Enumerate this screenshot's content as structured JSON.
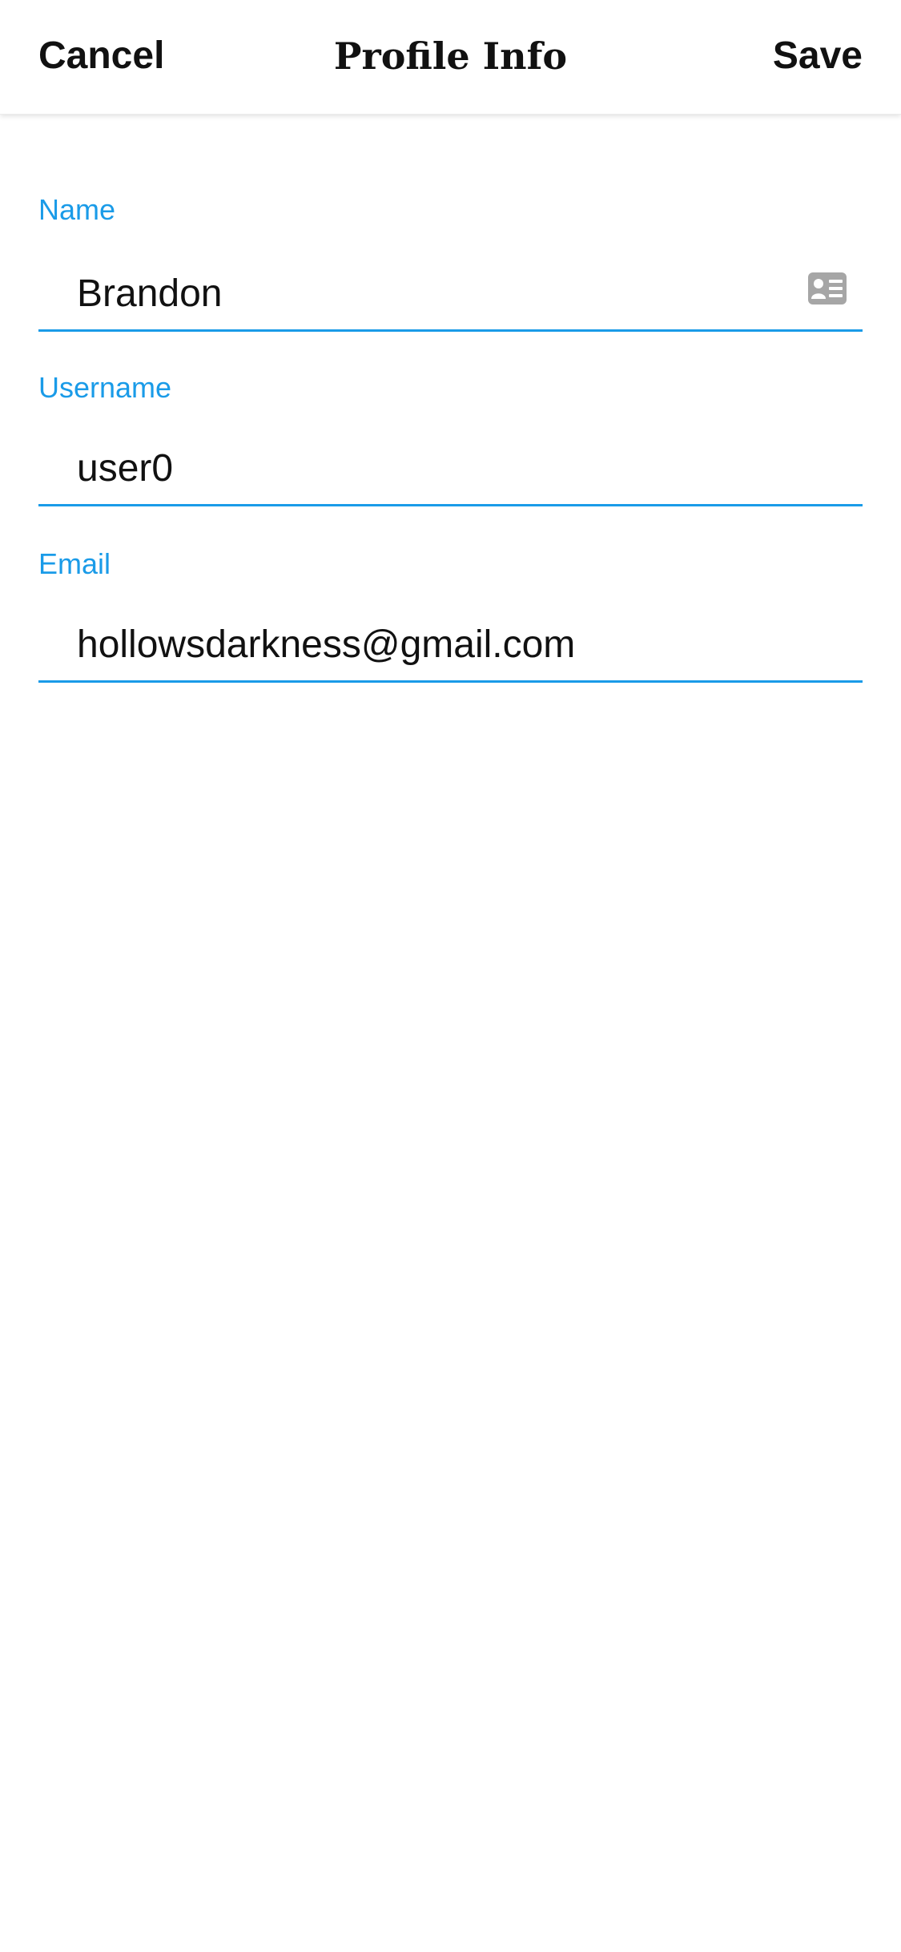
{
  "nav": {
    "cancel_label": "Cancel",
    "title": "Profile Info",
    "save_label": "Save"
  },
  "fields": [
    {
      "label": "Name",
      "value": "Brandon"
    },
    {
      "label": "Username",
      "value": "user0"
    },
    {
      "label": "Email",
      "value": "hollowsdarkness@gmail.com"
    }
  ],
  "icons": {
    "name_field_icon": "contact-card-icon"
  },
  "colors": {
    "accent": "#1a9be8",
    "text": "#111111",
    "icon": "#a6a6a6"
  }
}
